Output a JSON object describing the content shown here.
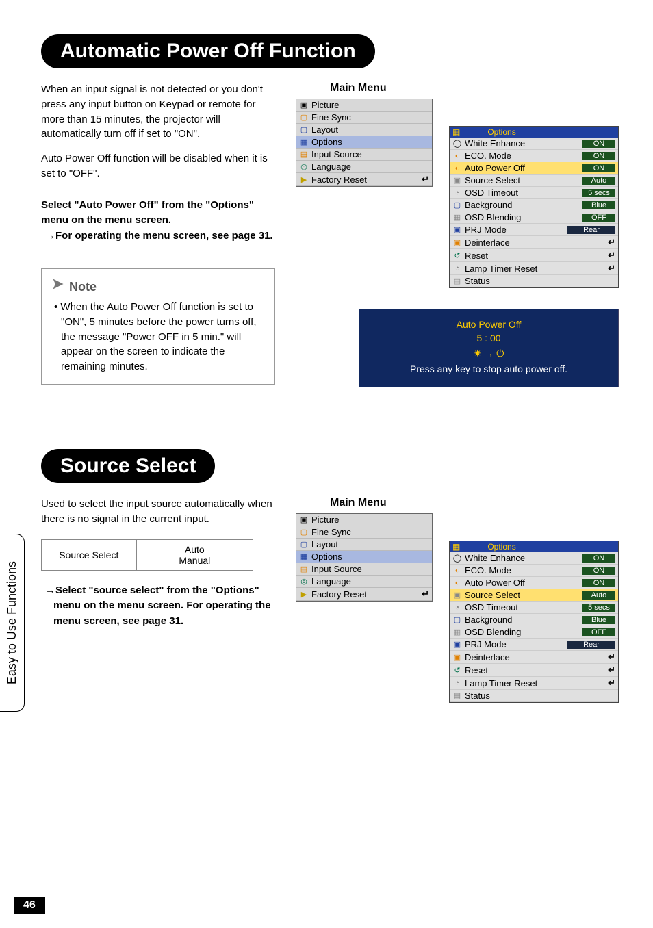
{
  "sideTab": "Easy to Use Functions",
  "pageNumber": "46",
  "section1": {
    "title": "Automatic Power Off Function",
    "p1": "When an input signal is not detected or you don't press any input button on Keypad or remote for more than 15 minutes, the projector will automatically turn off if set to \"ON\".",
    "p2": "Auto Power Off function will be disabled when it is set to \"OFF\".",
    "instr1": "Select \"Auto Power Off\" from the \"Options\" menu on the menu screen.",
    "instr2": "→For operating the menu screen, see page 31.",
    "noteLabel": "Note",
    "noteBody": "• When the Auto Power Off function is set to \"ON\", 5 minutes before the power turns off, the message \"Power OFF in 5 min.\" will appear on the screen to indicate the remaining minutes."
  },
  "section2": {
    "title": "Source Select",
    "p1": "Used to select the input source automatically when there is no signal in the current input.",
    "tableLeft": "Source Select",
    "tableR1": "Auto",
    "tableR2": "Manual",
    "instr": "→Select \"source select\" from the \"Options\" menu on the menu screen. For operating the menu screen, see page 31."
  },
  "mainMenuLabel": "Main Menu",
  "mainMenu": [
    {
      "icon": "▣",
      "label": "Picture",
      "cls": "ic-black"
    },
    {
      "icon": "▢",
      "label": "Fine Sync",
      "cls": "ic-orange"
    },
    {
      "icon": "▢",
      "label": "Layout",
      "cls": "ic-blue"
    },
    {
      "icon": "▦",
      "label": "Options",
      "cls": "ic-blue",
      "selected": true
    },
    {
      "icon": "▤",
      "label": "Input Source",
      "cls": "ic-orange"
    },
    {
      "icon": "◎",
      "label": "Language",
      "cls": "ic-green"
    },
    {
      "icon": "▶",
      "label": "Factory Reset",
      "cls": "ic-yellow",
      "enter": true
    }
  ],
  "optionsHeader": {
    "icon": "▦",
    "label": "Options"
  },
  "optionsA": [
    {
      "icon": "◯",
      "label": "White Enhance",
      "value": "ON",
      "type": "val"
    },
    {
      "icon": "◐",
      "label": "ECO. Mode",
      "value": "ON",
      "type": "val",
      "iconCls": "ic-orange"
    },
    {
      "icon": "◐",
      "label": "Auto Power Off",
      "value": "ON",
      "type": "val",
      "sel": true,
      "iconCls": "ic-orange"
    },
    {
      "icon": "▣",
      "label": "Source Select",
      "value": "Auto",
      "type": "val",
      "iconCls": "ic-gray"
    },
    {
      "icon": "◔",
      "label": "OSD Timeout",
      "value": "5 secs",
      "type": "val",
      "iconCls": "ic-gray"
    },
    {
      "icon": "▢",
      "label": "Background",
      "value": "Blue",
      "type": "val",
      "iconCls": "ic-blue"
    },
    {
      "icon": "▦",
      "label": "OSD Blending",
      "value": "OFF",
      "type": "val",
      "iconCls": "ic-gray"
    },
    {
      "icon": "▣",
      "label": "PRJ Mode",
      "value": "Rear",
      "type": "wide",
      "iconCls": "ic-blue"
    },
    {
      "icon": "▣",
      "label": "Deinterlace",
      "type": "enter",
      "iconCls": "ic-orange"
    },
    {
      "icon": "↺",
      "label": "Reset",
      "type": "enter",
      "iconCls": "ic-green"
    },
    {
      "icon": "◔",
      "label": "Lamp Timer Reset",
      "type": "enter",
      "iconCls": "ic-gray"
    },
    {
      "icon": "▤",
      "label": "Status",
      "type": "none",
      "iconCls": "ic-gray"
    }
  ],
  "optionsB": [
    {
      "icon": "◯",
      "label": "White Enhance",
      "value": "ON",
      "type": "val"
    },
    {
      "icon": "◐",
      "label": "ECO. Mode",
      "value": "ON",
      "type": "val",
      "iconCls": "ic-orange"
    },
    {
      "icon": "◐",
      "label": "Auto Power Off",
      "value": "ON",
      "type": "val",
      "iconCls": "ic-orange"
    },
    {
      "icon": "▣",
      "label": "Source Select",
      "value": "Auto",
      "type": "val",
      "sel": true,
      "iconCls": "ic-gray"
    },
    {
      "icon": "◔",
      "label": "OSD Timeout",
      "value": "5 secs",
      "type": "val",
      "iconCls": "ic-gray"
    },
    {
      "icon": "▢",
      "label": "Background",
      "value": "Blue",
      "type": "val",
      "iconCls": "ic-blue"
    },
    {
      "icon": "▦",
      "label": "OSD Blending",
      "value": "OFF",
      "type": "val",
      "iconCls": "ic-gray"
    },
    {
      "icon": "▣",
      "label": "PRJ Mode",
      "value": "Rear",
      "type": "wide",
      "iconCls": "ic-blue"
    },
    {
      "icon": "▣",
      "label": "Deinterlace",
      "type": "enter",
      "iconCls": "ic-orange"
    },
    {
      "icon": "↺",
      "label": "Reset",
      "type": "enter",
      "iconCls": "ic-green"
    },
    {
      "icon": "◔",
      "label": "Lamp Timer Reset",
      "type": "enter",
      "iconCls": "ic-gray"
    },
    {
      "icon": "▤",
      "label": "Status",
      "type": "none",
      "iconCls": "ic-gray"
    }
  ],
  "countdown": {
    "title": "Auto Power Off",
    "time": "5   :   00",
    "msg": "Press any key to stop auto power off."
  }
}
